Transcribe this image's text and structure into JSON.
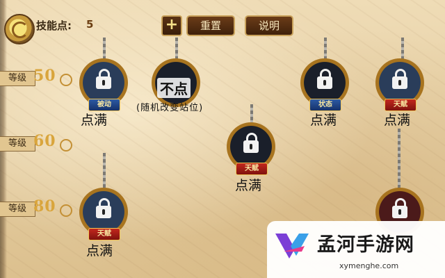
{
  "header": {
    "skill_points_label": "技能点:",
    "skill_points_value": "5",
    "plus_label": "+",
    "reset_label": "重置",
    "help_label": "说明"
  },
  "levels": [
    {
      "tag": "等级",
      "value": "50"
    },
    {
      "tag": "等级",
      "value": "60"
    },
    {
      "tag": "等级",
      "value": "80"
    }
  ],
  "nodes": [
    {
      "badge": "被动",
      "status": "点满"
    },
    {
      "badge": "",
      "status": "不点",
      "note": "(随机改变站位)"
    },
    {
      "badge": "状态",
      "status": "点满"
    },
    {
      "badge": "天赋",
      "status": "点满"
    },
    {
      "badge": "天赋",
      "status": "点满"
    },
    {
      "badge": "天赋",
      "status": "点满"
    },
    {
      "badge": "",
      "status": ""
    }
  ],
  "watermark": {
    "title": "孟河手游网",
    "url": "xymenghe.com"
  },
  "colors": {
    "parchment": "#e9d6ae",
    "button_bg": "#5a3214",
    "button_border": "#c9a25b",
    "badge_red": "#c3271d",
    "ring_gold": "#f1c657",
    "watermark_purple": "#7b3fd6"
  }
}
